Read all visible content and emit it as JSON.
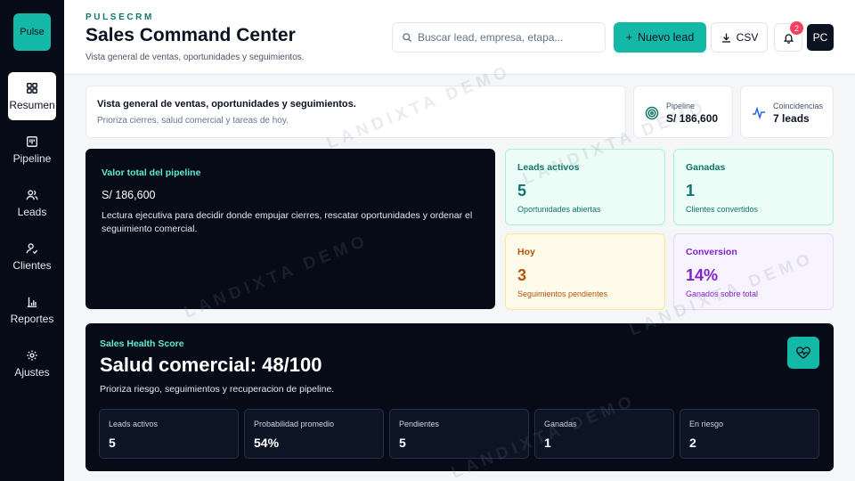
{
  "sidebar": {
    "logo": "Pulse",
    "items": [
      {
        "label": "Resumen",
        "icon": "grid-icon",
        "active": true
      },
      {
        "label": "Pipeline",
        "icon": "kanban-icon"
      },
      {
        "label": "Leads",
        "icon": "users-icon"
      },
      {
        "label": "Clientes",
        "icon": "user-check-icon"
      },
      {
        "label": "Reportes",
        "icon": "bar-chart-icon"
      },
      {
        "label": "Ajustes",
        "icon": "gear-icon"
      }
    ]
  },
  "header": {
    "brand": "PULSECRM",
    "title": "Sales Command Center",
    "subtitle": "Vista general de ventas, oportunidades y seguimientos.",
    "search_placeholder": "Buscar lead, empresa, etapa...",
    "new_lead_label": "Nuevo lead",
    "csv_label": "CSV",
    "notification_count": "2",
    "avatar_initials": "PC"
  },
  "overview": {
    "heading": "Vista general de ventas, oportunidades y seguimientos.",
    "subtext": "Prioriza cierres, salud comercial y tareas de hoy.",
    "pipeline_label": "Pipeline",
    "pipeline_value": "S/ 186,600",
    "matches_label": "Coincidencias",
    "matches_value": "7 leads"
  },
  "pipeline_panel": {
    "heading": "Valor total del pipeline",
    "value": "S/ 186,600",
    "description": "Lectura ejecutiva para decidir donde empujar cierres, rescatar oportunidades y ordenar el seguimiento comercial."
  },
  "stats": [
    {
      "label": "Leads activos",
      "value": "5",
      "sub": "Oportunidades abiertas",
      "color": "#0f766e",
      "bg": "#ecfdf7",
      "border": "#a7f3d0"
    },
    {
      "label": "Ganadas",
      "value": "1",
      "sub": "Clientes convertidos",
      "color": "#0f766e",
      "bg": "#ecfdf7",
      "border": "#a7f3d0"
    },
    {
      "label": "Hoy",
      "value": "3",
      "sub": "Seguimientos pendientes",
      "color": "#b45309",
      "bg": "#fffbeb",
      "border": "#fde68a"
    },
    {
      "label": "Conversion",
      "value": "14%",
      "sub": "Ganados sobre total",
      "color": "#7e22ce",
      "bg": "#f8f4ff",
      "border": "#e9d5ff"
    }
  ],
  "health": {
    "heading": "Sales Health Score",
    "title": "Salud comercial: 48/100",
    "subtitle": "Prioriza riesgo, seguimientos y recuperacion de pipeline.",
    "metrics": [
      {
        "label": "Leads activos",
        "value": "5"
      },
      {
        "label": "Probabilidad promedio",
        "value": "54%"
      },
      {
        "label": "Pendientes",
        "value": "5"
      },
      {
        "label": "Ganadas",
        "value": "1"
      },
      {
        "label": "En riesgo",
        "value": "2"
      }
    ]
  },
  "watermark": "LANDIXTA DEMO",
  "colors": {
    "accent": "#14b8a6",
    "dark": "#060b17",
    "badge": "#f43f5e"
  }
}
